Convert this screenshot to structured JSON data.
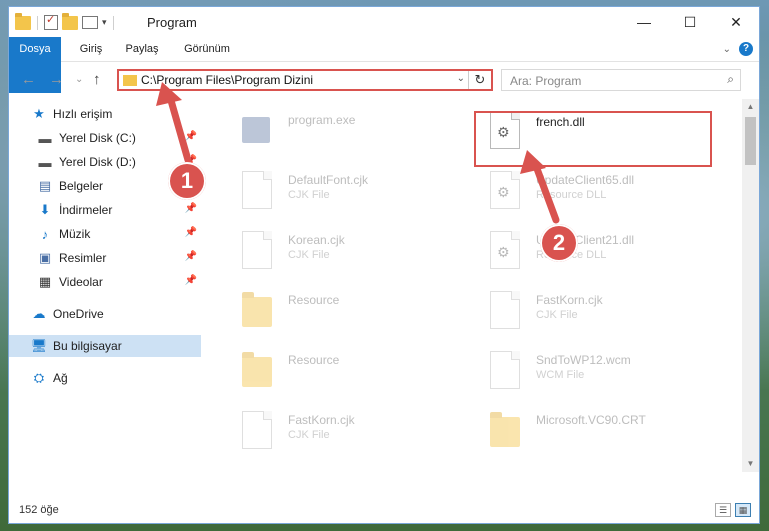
{
  "window": {
    "title": "Program",
    "buttons": {
      "minimize": "—",
      "maximize": "☐",
      "close": "✕"
    }
  },
  "ribbon": {
    "tabs": [
      "Dosya",
      "Giriş",
      "Paylaş",
      "Görünüm"
    ],
    "help": "?"
  },
  "navigation": {
    "address_path": "C:\\Program Files\\Program Dizini",
    "search_placeholder": "Ara: Program"
  },
  "sidebar": {
    "items": [
      {
        "label": "Hızlı erişim",
        "icon": "star-icon"
      },
      {
        "label": "Yerel Disk (C:)",
        "icon": "drive-icon",
        "pinned": true
      },
      {
        "label": "Yerel Disk (D:)",
        "icon": "drive-icon",
        "pinned": true
      },
      {
        "label": "Belgeler",
        "icon": "documents-icon",
        "pinned": true
      },
      {
        "label": "İndirmeler",
        "icon": "download-icon",
        "pinned": true
      },
      {
        "label": "Müzik",
        "icon": "music-icon",
        "pinned": true
      },
      {
        "label": "Resimler",
        "icon": "pictures-icon",
        "pinned": true
      },
      {
        "label": "Videolar",
        "icon": "videos-icon",
        "pinned": true
      },
      {
        "label": "OneDrive",
        "icon": "cloud-icon"
      },
      {
        "label": "Bu bilgisayar",
        "icon": "computer-icon",
        "selected": true
      },
      {
        "label": "Ağ",
        "icon": "network-icon"
      }
    ]
  },
  "files": [
    {
      "name": "program.exe",
      "type": "",
      "icon": "exe-icon"
    },
    {
      "name": "french.dll",
      "type": "",
      "icon": "dll-icon",
      "highlighted": true
    },
    {
      "name": "DefaultFont.cjk",
      "type": "CJK File",
      "icon": "file-icon"
    },
    {
      "name": "UpdateClient65.dll",
      "type": "Resource DLL",
      "icon": "dll-icon"
    },
    {
      "name": "Korean.cjk",
      "type": "CJK File",
      "icon": "file-icon"
    },
    {
      "name": "UpdateClient21.dll",
      "type": "Resource DLL",
      "icon": "dll-icon"
    },
    {
      "name": "Resource",
      "type": "",
      "icon": "folder-icon"
    },
    {
      "name": "FastKorn.cjk",
      "type": "CJK File",
      "icon": "file-icon"
    },
    {
      "name": "Resource",
      "type": "",
      "icon": "folder-icon"
    },
    {
      "name": "SndToWP12.wcm",
      "type": "WCM File",
      "icon": "file-icon"
    },
    {
      "name": "FastKorn.cjk",
      "type": "CJK File",
      "icon": "file-icon"
    },
    {
      "name": "Microsoft.VC90.CRT",
      "type": "",
      "icon": "zip-folder-icon"
    }
  ],
  "status": {
    "item_count": "152 öğe"
  },
  "annotations": {
    "callout_1": "1",
    "callout_2": "2"
  },
  "colors": {
    "accent": "#1979ca",
    "highlight": "#d9534f",
    "selection": "#cde1f4"
  }
}
